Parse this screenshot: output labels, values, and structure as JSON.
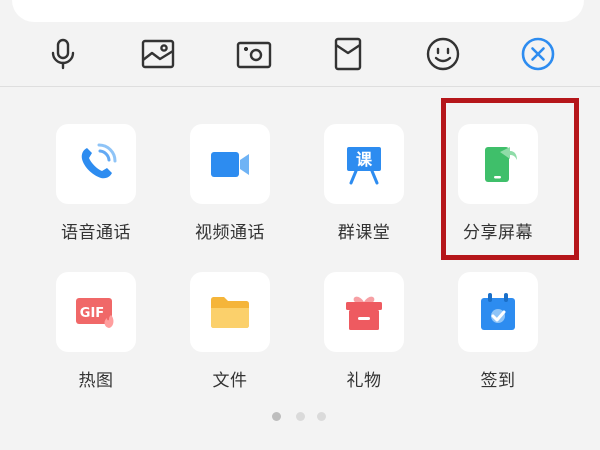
{
  "toolbar": {
    "icons": [
      "microphone-icon",
      "image-icon",
      "camera-icon",
      "red-packet-icon",
      "emoji-icon",
      "close-icon"
    ]
  },
  "panel": {
    "row1": [
      {
        "label": "语音通话",
        "icon": "phone-icon"
      },
      {
        "label": "视频通话",
        "icon": "video-camera-icon"
      },
      {
        "label": "群课堂",
        "icon": "classroom-icon",
        "icon_text": "课"
      },
      {
        "label": "分享屏幕",
        "icon": "share-screen-icon"
      }
    ],
    "row2": [
      {
        "label": "热图",
        "icon": "gif-icon",
        "icon_text": "GIF"
      },
      {
        "label": "文件",
        "icon": "folder-icon"
      },
      {
        "label": "礼物",
        "icon": "gift-icon"
      },
      {
        "label": "签到",
        "icon": "checkin-calendar-icon"
      }
    ]
  },
  "pagination": {
    "pages": 3,
    "current": 1
  },
  "colors": {
    "accent": "#2d8cf0",
    "highlight": "#b5161a",
    "green": "#3fbf6a"
  }
}
